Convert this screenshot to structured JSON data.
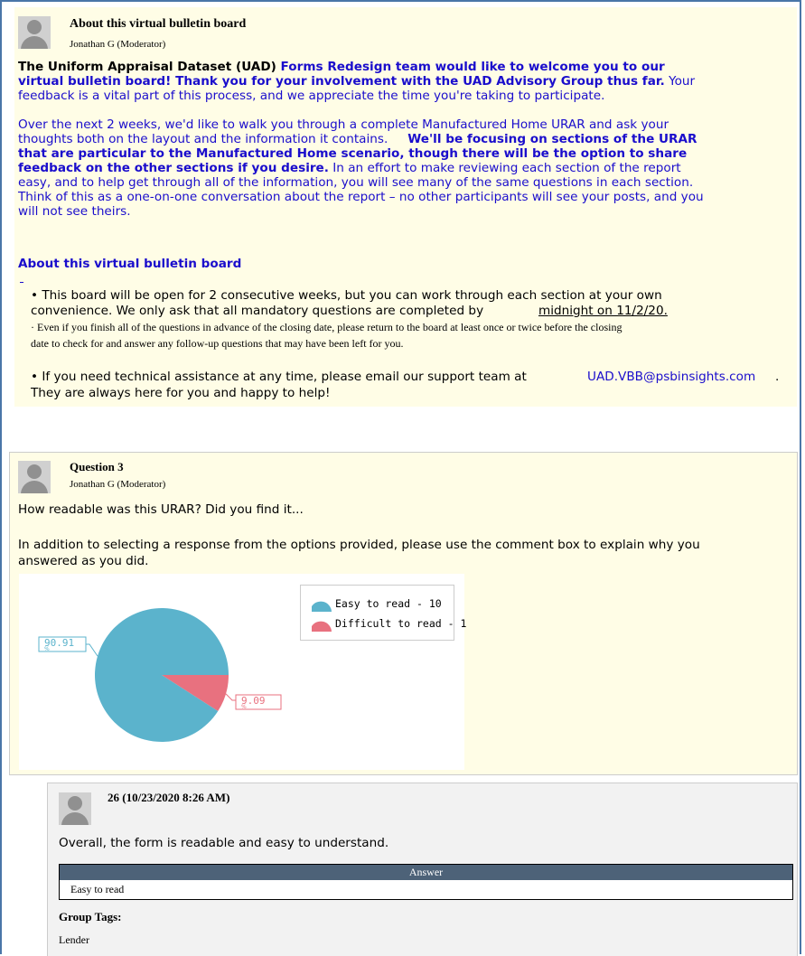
{
  "post1": {
    "title": "About this virtual bulletin board",
    "author": "Jonathan G (Moderator)",
    "lines": [
      {
        "a": "The Uniform Appraisal Dataset (UAD)",
        "b": " Forms Redesign team would like to welcome you to our"
      },
      {
        "b": "virtual bulletin board! Thank you for your involvement with the UAD Advisory Group thus far.",
        "c": " Your"
      },
      {
        "c": "feedback is a vital part of this process, and we appreciate the time you're taking to participate."
      },
      {
        "c": "Over the next 2 weeks, we'd like to walk you through a complete Manufactured Home URAR and ask your"
      },
      {
        "c": "thoughts both on the layout and the information it contains.",
        "b": "We'll be focusing on sections of the URAR"
      },
      {
        "b": "that are particular to the Manufactured Home scenario, though there will be the option to share"
      },
      {
        "b": "feedback on the other sections if you desire.",
        "c": " In an effort to make reviewing each section of the report"
      },
      {
        "c": "easy, and to help get through all of the information, you will see many of the same questions in each section."
      },
      {
        "c": "Think of this as a one-on-one conversation about the report – no other participants will see your posts, and you"
      },
      {
        "c": "will not see theirs."
      }
    ],
    "subheading": "About this virtual bulletin board",
    "bullet1_line1": "• This board will be open for 2 consecutive weeks, but you can work through each section at your own",
    "bullet1_line2": "convenience. We only ask that all mandatory questions are completed by",
    "deadline": "midnight on 11/2/20.",
    "note_line1": "· Even if you finish all of the questions in advance of the closing date, please return to the board at least once or twice before the closing",
    "note_line2": "date to check for and answer any follow-up questions that may have been left for you.",
    "bullet2_line1": "• If you need technical assistance at any time, please email our support team at",
    "email": "UAD.VBB@psbinsights.com",
    "bullet2_end": ".",
    "bullet2_line2": "They are always here for you and happy to help!"
  },
  "post2": {
    "title": "Question 3",
    "author": "Jonathan G (Moderator)",
    "question": "How readable was this URAR? Did you find it...",
    "instruction_line1": "In addition to selecting a response from the options provided, please use the comment box to explain why you",
    "instruction_line2": "answered as you did."
  },
  "chart_data": {
    "type": "pie",
    "slices": [
      {
        "label": "Easy to read - 10",
        "value": 90.91,
        "color": "#5bb3cc"
      },
      {
        "label": "Difficult to read - 1",
        "value": 9.09,
        "color": "#e8717f"
      }
    ],
    "data_labels": [
      "90.91",
      "9.09"
    ],
    "data_label_unit": "%",
    "legend_position": "top-right"
  },
  "reply": {
    "header": "26 (10/23/2020 8:26 AM)",
    "comment": "Overall, the form is readable and easy to understand.",
    "answer_header": "Answer",
    "answer_value": "Easy to read",
    "group_tags_label": "Group Tags:",
    "group_tag": "Lender"
  }
}
